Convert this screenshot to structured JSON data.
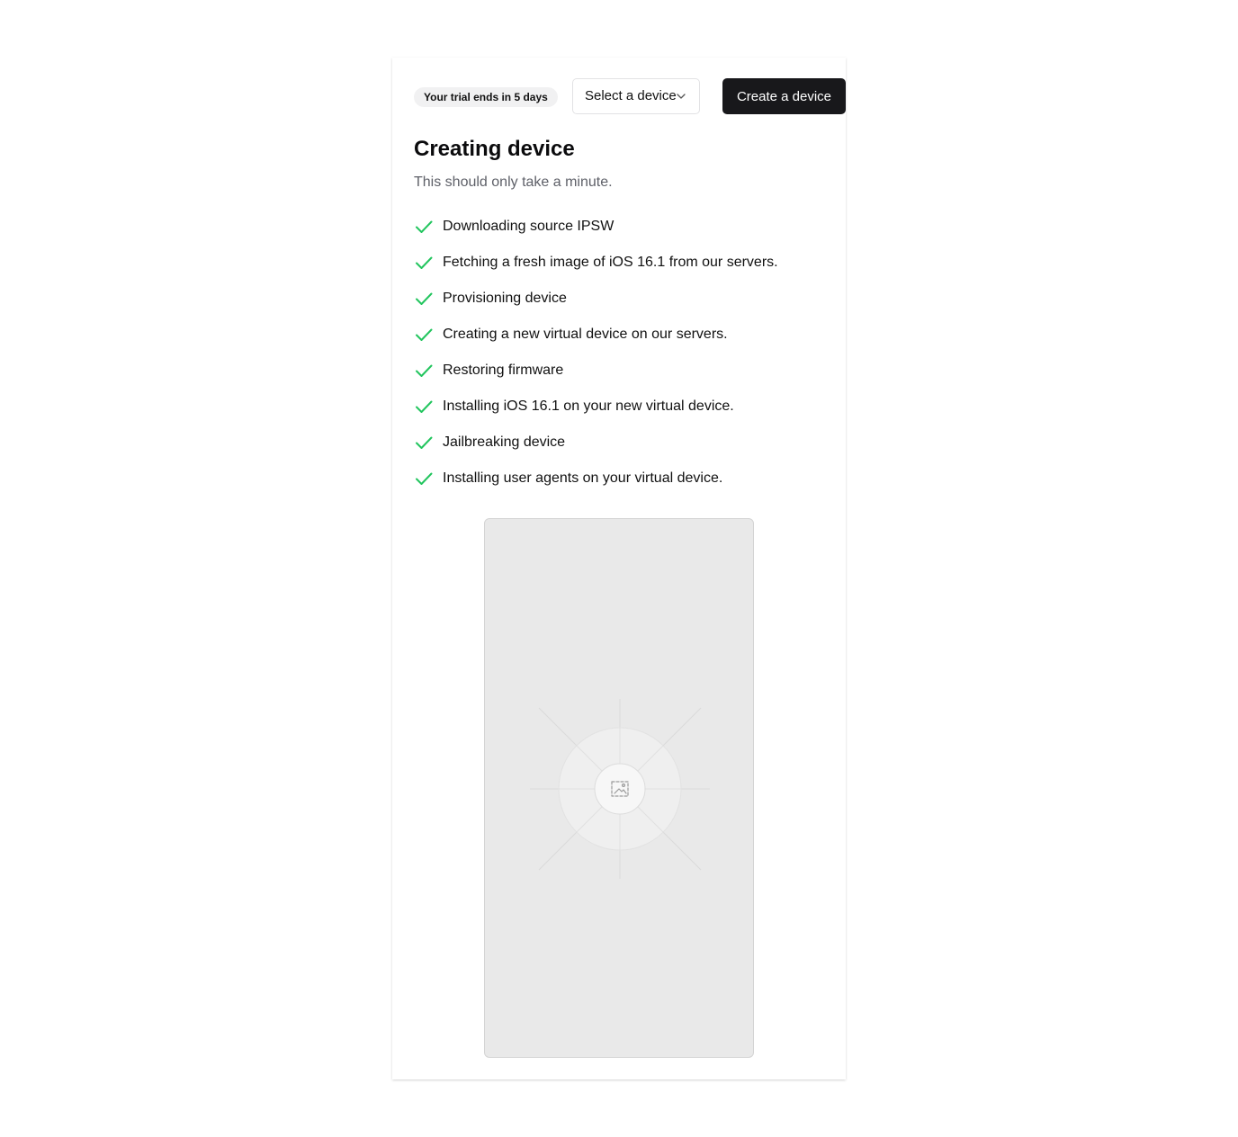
{
  "header": {
    "trial_badge": "Your trial ends in 5 days",
    "device_select": {
      "selected": "Select a device",
      "icon": "chevron-down-icon"
    },
    "create_button": "Create a device"
  },
  "main": {
    "title": "Creating device",
    "subtitle": "This should only take a minute.",
    "steps": [
      {
        "label": "Downloading source IPSW",
        "status": "done"
      },
      {
        "label": "Fetching a fresh image of iOS 16.1 from our servers.",
        "status": "done"
      },
      {
        "label": "Provisioning device",
        "status": "done"
      },
      {
        "label": "Creating a new virtual device on our servers.",
        "status": "done"
      },
      {
        "label": "Restoring firmware",
        "status": "done"
      },
      {
        "label": "Installing iOS 16.1 on your new virtual device.",
        "status": "done"
      },
      {
        "label": "Jailbreaking device",
        "status": "done"
      },
      {
        "label": "Installing user agents on your virtual device.",
        "status": "done"
      }
    ],
    "preview": {
      "icon": "image-placeholder-icon"
    }
  },
  "colors": {
    "check": "#22c55e",
    "button_bg": "#18181b",
    "button_text": "#ffffff",
    "badge_bg": "#f1f1f2",
    "subtitle": "#5f6169",
    "preview_bg": "#e9e9e9"
  }
}
